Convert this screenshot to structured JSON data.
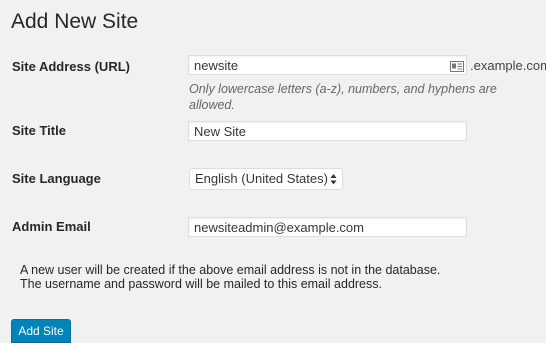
{
  "page": {
    "title": "Add New Site"
  },
  "site_address": {
    "label": "Site Address (URL)",
    "value": "newsite",
    "suffix": ".example.com",
    "hint": "Only lowercase letters (a-z), numbers, and hyphens are allowed.",
    "icon": "address-card-icon"
  },
  "site_title": {
    "label": "Site Title",
    "value": "New Site"
  },
  "site_language": {
    "label": "Site Language",
    "selected": "English (United States)",
    "icon": "up-down-arrows-icon"
  },
  "admin_email": {
    "label": "Admin Email",
    "value": "newsiteadmin@example.com"
  },
  "note": {
    "line1": "A new user will be created if the above email address is not in the database.",
    "line2": "The username and password will be mailed to this email address."
  },
  "actions": {
    "submit_label": "Add Site"
  },
  "colors": {
    "background": "#f1f1f1",
    "primary_button": "#0085ba",
    "text": "#23282d",
    "hint_text": "#666666"
  }
}
